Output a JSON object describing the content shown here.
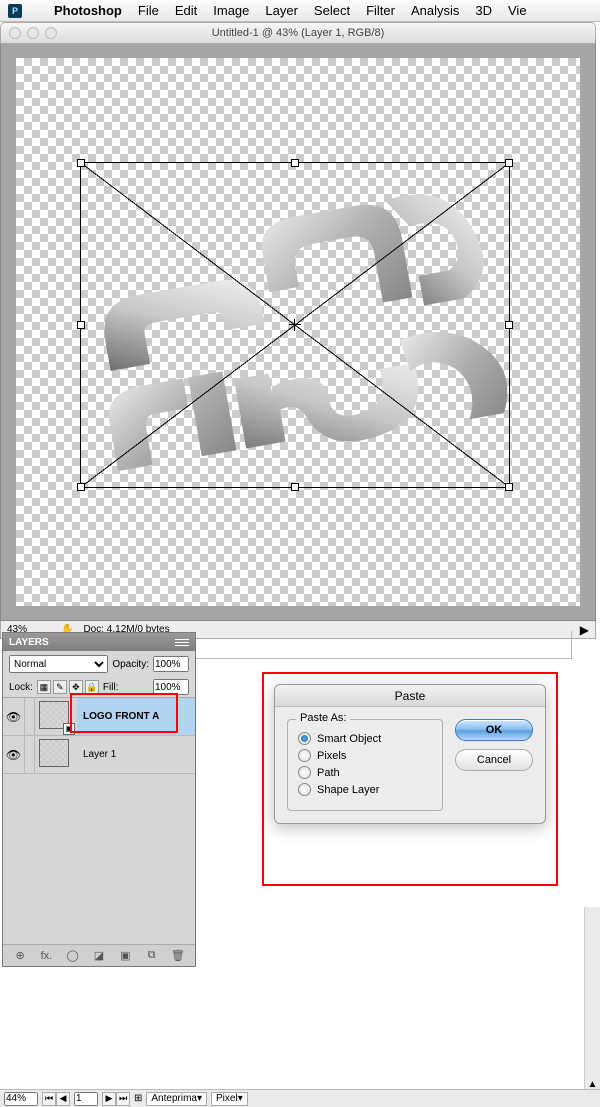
{
  "menubar": {
    "appname": "Photoshop",
    "items": [
      "File",
      "Edit",
      "Image",
      "Layer",
      "Select",
      "Filter",
      "Analysis",
      "3D",
      "Vie"
    ]
  },
  "document": {
    "title": "Untitled-1 @ 43% (Layer 1, RGB/8)",
    "zoom": "43%",
    "doc_info": "Doc: 4,12M/0 bytes"
  },
  "layers_panel": {
    "title": "LAYERS",
    "blend_mode": "Normal",
    "opacity_label": "Opacity:",
    "opacity_value": "100%",
    "lock_label": "Lock:",
    "fill_label": "Fill:",
    "fill_value": "100%",
    "layers": [
      {
        "name": "LOGO FRONT A",
        "selected": true,
        "visible": true,
        "smart": true
      },
      {
        "name": "Layer 1",
        "selected": false,
        "visible": true,
        "smart": false
      }
    ],
    "footer_icons": [
      "⊕",
      "fx.",
      "◯",
      "◪",
      "▣",
      "⧉",
      "🗑"
    ]
  },
  "paste_dialog": {
    "title": "Paste",
    "legend": "Paste As:",
    "options": [
      "Smart Object",
      "Pixels",
      "Path",
      "Shape Layer"
    ],
    "selected": "Smart Object",
    "ok": "OK",
    "cancel": "Cancel"
  },
  "bottom": {
    "zoom": "44%",
    "page": "1",
    "dropdown": "Anteprima",
    "unit": "Pixel"
  }
}
